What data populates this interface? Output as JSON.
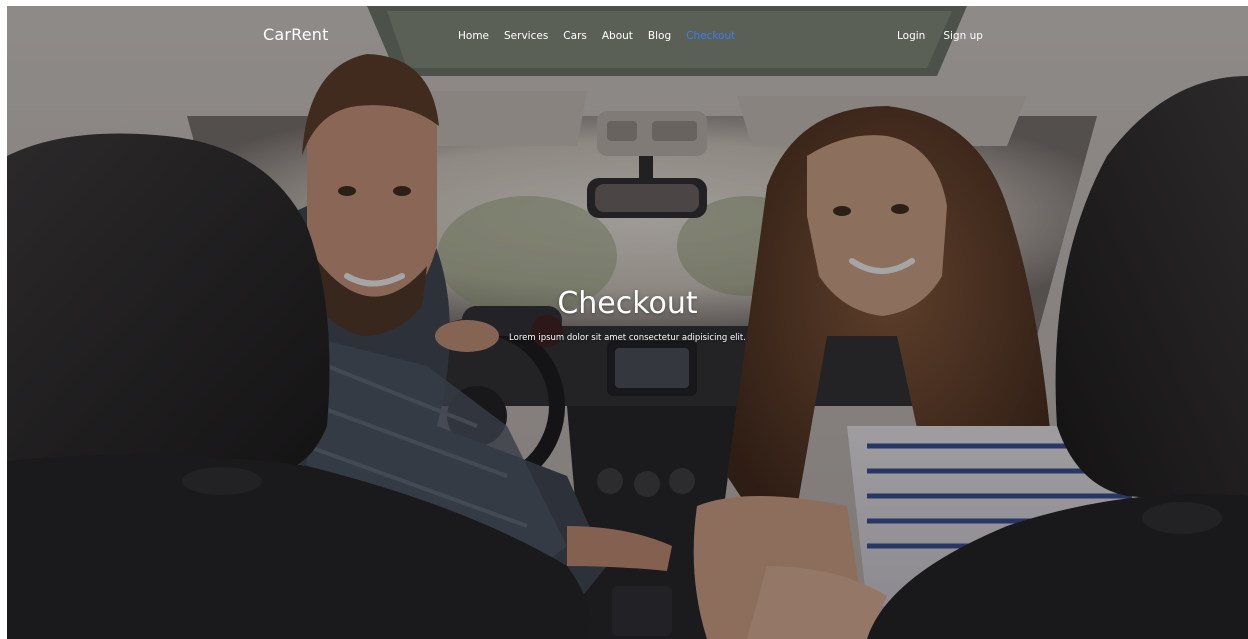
{
  "brand": "CarRent",
  "nav": {
    "items": [
      {
        "label": "Home"
      },
      {
        "label": "Services"
      },
      {
        "label": "Cars"
      },
      {
        "label": "About"
      },
      {
        "label": "Blog"
      },
      {
        "label": "Checkout",
        "active": true
      }
    ],
    "login": "Login",
    "signup": "Sign up"
  },
  "hero": {
    "title": "Checkout",
    "subtitle": "Lorem ipsum dolor sit amet consectetur adipisicing elit."
  },
  "colors": {
    "active_link": "#3d7cf5",
    "text": "#ffffff"
  }
}
